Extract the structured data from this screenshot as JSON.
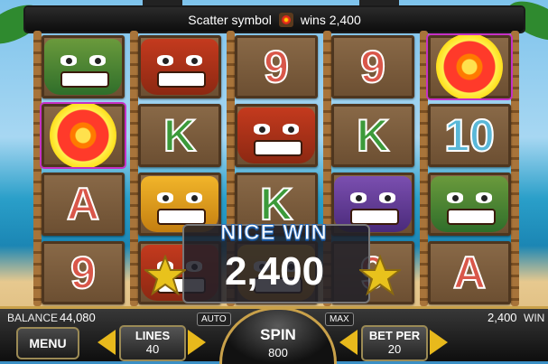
{
  "banner": {
    "text_before": "Scatter symbol",
    "text_after": "wins 2,400",
    "icon": "scatter-flower-icon"
  },
  "reels": [
    [
      "mask-green",
      "flower",
      "A",
      "9"
    ],
    [
      "mask-red",
      "K",
      "mask-gold",
      "mask-red"
    ],
    [
      "9",
      "mask-red",
      "K",
      "mask-gold"
    ],
    [
      "9",
      "K",
      "mask-purple",
      "9"
    ],
    [
      "flower",
      "10",
      "mask-green",
      "A"
    ]
  ],
  "highlighted_cells": [
    "reel0-row1",
    "reel4-row0"
  ],
  "win": {
    "headline": "NICE WIN",
    "amount": "2,400"
  },
  "controls": {
    "balance_label": "BALANCE",
    "balance_value": "44,080",
    "win_value": "2,400",
    "win_label": "WIN",
    "menu_label": "MENU",
    "lines_label": "LINES",
    "lines_value": "40",
    "auto_label": "AUTO",
    "max_label": "MAX",
    "spin_label": "SPIN",
    "spin_value": "800",
    "bet_label": "BET PER",
    "bet_value": "20"
  },
  "colors": {
    "accent": "#e8b91c",
    "highlight": "#c531c5",
    "panel": "#1e1e28"
  }
}
